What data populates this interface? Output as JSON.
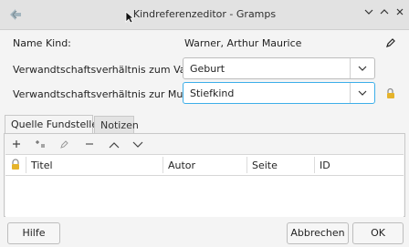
{
  "window": {
    "title": "Kindreferenzeditor - Gramps"
  },
  "form": {
    "name_label": "Name Kind:",
    "name_value": "Warner, Arthur Maurice",
    "father_label": "Verwandtschaftsverhältnis zum Vater:",
    "father_value": "Geburt",
    "mother_label": "Verwandtschaftsverhältnis zur Mutter:",
    "mother_value": "Stiefkind"
  },
  "tabs": [
    {
      "label": "Quelle Fundstellen"
    },
    {
      "label": "Notizen"
    }
  ],
  "toolbar": {
    "icons": [
      "add-icon",
      "share-icon",
      "edit-icon",
      "remove-icon",
      "move-up-icon",
      "move-down-icon"
    ]
  },
  "table": {
    "columns": [
      "Titel",
      "Autor",
      "Seite",
      "ID"
    ]
  },
  "buttons": {
    "help": "Hilfe",
    "cancel": "Abbrechen",
    "ok": "OK"
  },
  "colors": {
    "accent": "#3daee9",
    "lock": "#e5b32b"
  }
}
